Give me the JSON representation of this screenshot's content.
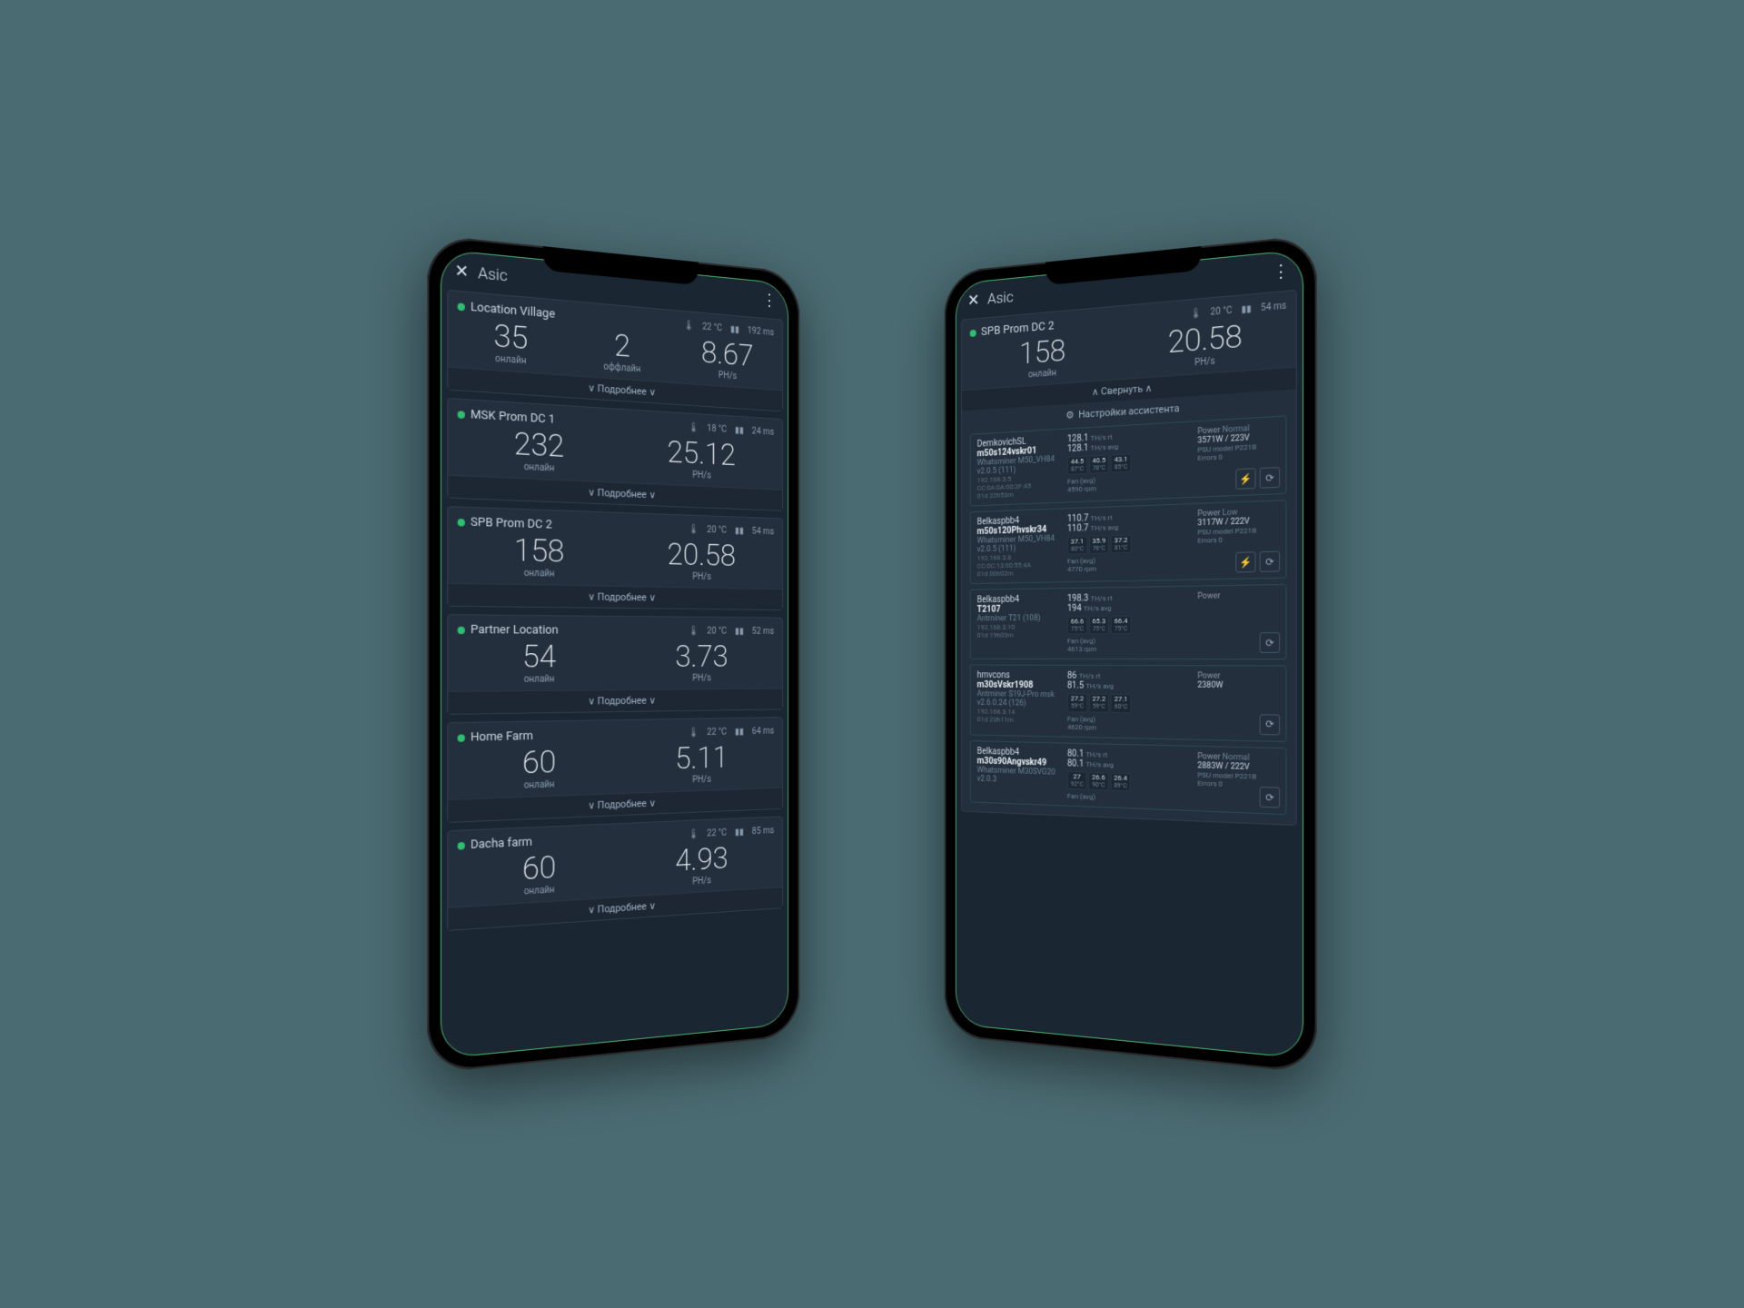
{
  "app_title": "Asic",
  "labels": {
    "online": "онлайн",
    "offline": "оффлайн",
    "hashrate_unit": "PH/s",
    "more": "Подробнее",
    "collapse": "Свернуть",
    "assistant": "Настройки ассистента",
    "power": "Power",
    "psu_model": "PSU model",
    "errors": "Errors",
    "fan_avg": "Fan (avg)",
    "ths_rt": "TH/s rt",
    "ths_avg": "TH/s avg"
  },
  "icons": {
    "close": "✕",
    "menu_dots": "⋮",
    "thermo": "🌡",
    "signal": "▮▮",
    "chevron_down": "∨",
    "chevron_up": "∧",
    "gear": "⚙",
    "bolt": "⚡",
    "restart": "⟳"
  },
  "left_locations": [
    {
      "name": "Location Village",
      "temp": "22 °C",
      "ping": "192 ms",
      "online": "35",
      "offline": "2",
      "hashrate": "8.67",
      "has_offline": true
    },
    {
      "name": "MSK Prom DC 1",
      "temp": "18 °C",
      "ping": "24 ms",
      "online": "232",
      "hashrate": "25.12",
      "has_offline": false
    },
    {
      "name": "SPB Prom DC 2",
      "temp": "20 °C",
      "ping": "54 ms",
      "online": "158",
      "hashrate": "20.58",
      "has_offline": false
    },
    {
      "name": "Partner Location",
      "temp": "20 °C",
      "ping": "52 ms",
      "online": "54",
      "hashrate": "3.73",
      "has_offline": false
    },
    {
      "name": "Home Farm",
      "temp": "22 °C",
      "ping": "64 ms",
      "online": "60",
      "hashrate": "5.11",
      "has_offline": false
    },
    {
      "name": "Dacha farm",
      "temp": "22 °C",
      "ping": "85 ms",
      "online": "60",
      "hashrate": "4.93",
      "has_offline": false
    }
  ],
  "right_header": {
    "name": "SPB Prom DC 2",
    "temp": "20 °C",
    "ping": "54 ms",
    "online": "158",
    "hashrate": "20.58"
  },
  "miners": [
    {
      "owner": "DemkovichSL",
      "name": "m50s124vskr01",
      "model": "Whatsminer M50_VH84 v2.0.5 (111)",
      "ip": "192.168.3.5",
      "mac": "CC:0A:0A:00:2F:45",
      "uptime": "01d 22h53m",
      "hash_rt": "128.1",
      "hash_avg": "128.1",
      "temps": [
        [
          "44.5",
          "87°C"
        ],
        [
          "40.5",
          "78°C"
        ],
        [
          "43.1",
          "85°C"
        ]
      ],
      "fan": "4590 rpm",
      "pwr_status": "Normal",
      "pwr": "3571W / 223V",
      "psu": "P221B",
      "errors": "0",
      "has_bolt": true
    },
    {
      "owner": "Belkaspbb4",
      "name": "m50s120Phvskr34",
      "model": "Whatsminer M50_VH84 v2.0.5 (111)",
      "ip": "192.168.3.8",
      "mac": "CC:0C:13:00:55:4A",
      "uptime": "01d 00h02m",
      "hash_rt": "110.7",
      "hash_avg": "110.7",
      "temps": [
        [
          "37.1",
          "80°C"
        ],
        [
          "35.9",
          "76°C"
        ],
        [
          "37.2",
          "81°C"
        ]
      ],
      "fan": "4770 rpm",
      "pwr_status": "Low",
      "pwr": "3117W / 222V",
      "psu": "P221B",
      "errors": "0",
      "has_bolt": true
    },
    {
      "owner": "Belkaspbb4",
      "name": "T2107",
      "model": "Antminer T21 (108)",
      "ip": "192.168.3.10",
      "mac": "",
      "uptime": "01d 19h03m",
      "hash_rt": "198.3",
      "hash_avg": "194",
      "temps": [
        [
          "66.6",
          "75°C"
        ],
        [
          "65.3",
          "75°C"
        ],
        [
          "66.4",
          "75°C"
        ]
      ],
      "fan": "4613 rpm",
      "pwr_status": "",
      "pwr": "",
      "psu": "",
      "errors": "",
      "has_bolt": false
    },
    {
      "owner": "hmvcons",
      "name": "m30sVskr1908",
      "model": "Antminer S19J-Pro msk v2.6.0.24 (126)",
      "ip": "192.168.3.14",
      "mac": "",
      "uptime": "01d 23h11m",
      "hash_rt": "86",
      "hash_avg": "81.5",
      "temps": [
        [
          "27.2",
          "59°C"
        ],
        [
          "27.2",
          "59°C"
        ],
        [
          "27.1",
          "60°C"
        ]
      ],
      "fan": "4620 rpm",
      "pwr_status": "",
      "pwr": "2380W",
      "psu": "",
      "errors": "",
      "has_bolt": false
    },
    {
      "owner": "Belkaspbb4",
      "name": "m30s90Angvskr49",
      "model": "Whatsminer M30SVG20 v2.0.3",
      "ip": "",
      "mac": "",
      "uptime": "",
      "hash_rt": "80.1",
      "hash_avg": "80.1",
      "temps": [
        [
          "27",
          "92°C"
        ],
        [
          "26.6",
          "90°C"
        ],
        [
          "26.4",
          "89°C"
        ]
      ],
      "fan": "",
      "pwr_status": "Normal",
      "pwr": "2883W / 222V",
      "psu": "P221B",
      "errors": "0",
      "has_bolt": false
    }
  ]
}
